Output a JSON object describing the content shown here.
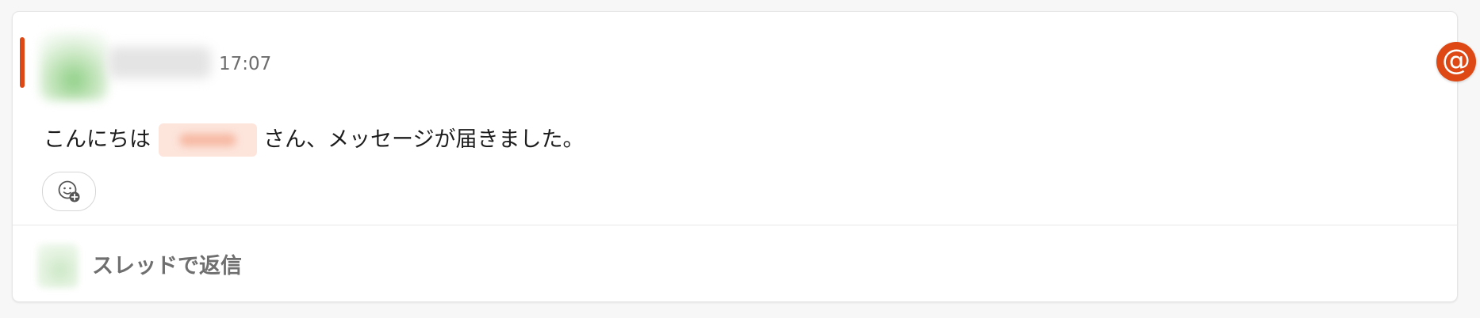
{
  "message": {
    "timestamp": "17:07",
    "text_before_mention": "こんにちは",
    "text_after_mention": "さん、メッセージが届きました。",
    "mention_badge": "@",
    "colors": {
      "accent": "#dd4814",
      "mention_bg": "#fde5dc"
    }
  },
  "reactions": {
    "add_reaction_icon": "emoji-add-icon"
  },
  "thread": {
    "reply_label": "スレッドで返信"
  }
}
